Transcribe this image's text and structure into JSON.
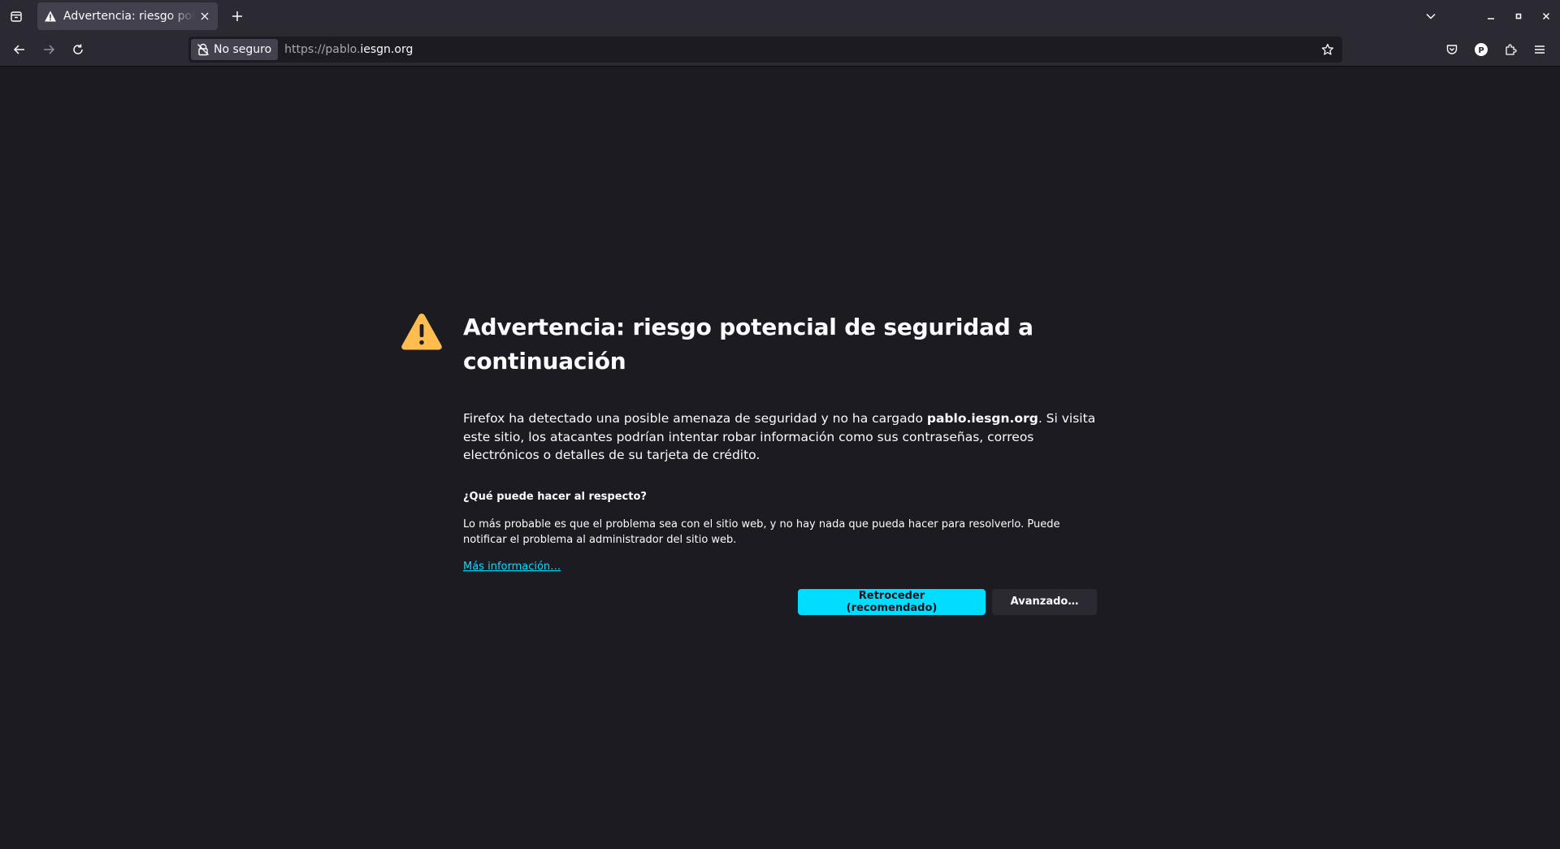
{
  "browser": {
    "tab": {
      "title": "Advertencia: riesgo potencial de seguridad a continuación"
    },
    "urlbar": {
      "identity_label": "No seguro",
      "url_prefix": "https://pablo.",
      "url_domain": "iesgn.org"
    },
    "toolbar_icons": [
      "pocket-icon",
      "profile-icon",
      "extensions-icon",
      "menu-icon"
    ],
    "profile_initial": "P"
  },
  "error_page": {
    "title": "Advertencia: riesgo potencial de seguridad a continuación",
    "intro_before": "Firefox ha detectado una posible amenaza de seguridad y no ha cargado ",
    "intro_host": "pablo.iesgn.org",
    "intro_after": ". Si visita este sitio, los atacantes podrían intentar robar información como sus contraseñas, correos electrónicos o detalles de su tarjeta de crédito.",
    "what_heading": "¿Qué puede hacer al respecto?",
    "what_body": "Lo más probable es que el problema sea con el sitio web, y no hay nada que pueda hacer para resolverlo. Puede notificar el problema al administrador del sitio web.",
    "learn_more": "Más información…",
    "go_back_label": "Retroceder (recomendado)",
    "advanced_label": "Avanzado…"
  },
  "colors": {
    "accent": "#00ddff",
    "warning": "#ffbd4f",
    "page_bg": "#1c1b22",
    "chrome_bg": "#2b2a33"
  }
}
